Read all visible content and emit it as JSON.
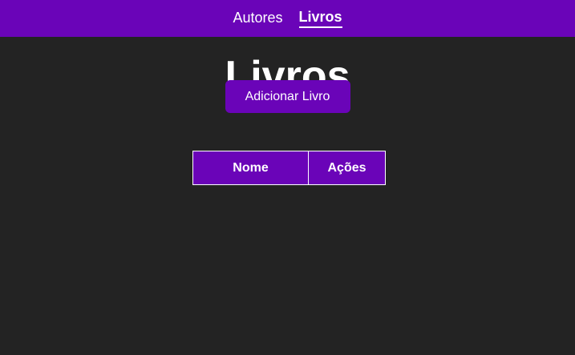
{
  "nav": {
    "items": [
      {
        "label": "Autores",
        "active": false
      },
      {
        "label": "Livros",
        "active": true
      }
    ]
  },
  "main": {
    "title": "Livros",
    "add_button_label": "Adicionar Livro"
  },
  "table": {
    "columns": [
      "Nome",
      "Ações"
    ],
    "rows": []
  },
  "colors": {
    "accent": "#6a04b8",
    "background": "#232323",
    "text": "#ffffff"
  }
}
